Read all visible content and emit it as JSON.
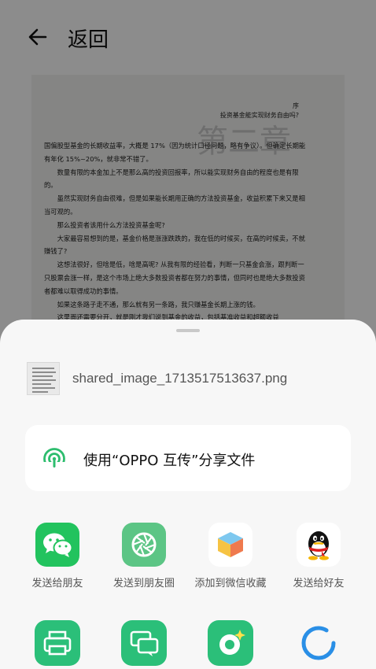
{
  "header": {
    "back_label": "返回"
  },
  "document": {
    "header_lines": [
      "序",
      "投资基金能实现财务自由吗?"
    ],
    "big_char": "第二章",
    "paragraphs": [
      {
        "indent": false,
        "text": "国偏股型基金的长期收益率，大概是 17%（因为统计口径问题，略有争议）。但确定长期能有年化 15%~20%，就非常不错了。"
      },
      {
        "indent": true,
        "text": "数量有限的本金加上不是那么高的投资回报率，所以能实现财务自由的程度也是有限的。"
      },
      {
        "indent": true,
        "text": "虽然实现财务自由很难，但是如果能长期用正确的方法投资基金，收益积累下来又是相当可观的。"
      },
      {
        "indent": true,
        "text": "那么投资者该用什么方法投资基金呢?"
      },
      {
        "indent": true,
        "text": "大家最容易想到的是，基金价格是涨涨跌跌的，我在低的时候买，在高的时候卖，不就赚钱了?"
      },
      {
        "indent": true,
        "text": "这想法很好，但啥是低，啥是高呢? 从我有限的经验看，判断一只基金会涨，跟判断一只股票会涨一样，是这个市场上绝大多数投资者都在努力的事情，但同时也是绝大多数投资者都难以取得成功的事情。"
      },
      {
        "indent": true,
        "text": "如果这条路子走不通，那么就有另一条路，我只赚基金长期上涨的钱。"
      },
      {
        "indent": true,
        "text": "这里面还需要分开，就是刚才我们说到基金的收益，包括基准收益和超额收益"
      }
    ]
  },
  "share_sheet": {
    "file_name": "shared_image_1713517513637.png",
    "oppo_share_label": "使用“OPPO 互传”分享文件",
    "apps_row1": [
      {
        "label": "发送给朋友",
        "icon": "wechat-icon",
        "color": "#2dc100"
      },
      {
        "label": "发送到朋友圈",
        "icon": "moments-icon",
        "color": "#5bc480"
      },
      {
        "label": "添加到微信收藏",
        "icon": "favorites-icon",
        "color": "#ffffff"
      },
      {
        "label": "发送给好友",
        "icon": "qq-icon",
        "color": "#ffffff"
      }
    ],
    "apps_row2": [
      {
        "icon": "print-icon",
        "color": "#2cc07a"
      },
      {
        "icon": "chat-bubbles-icon",
        "color": "#2cc07a"
      },
      {
        "icon": "camera-lens-icon",
        "color": "#2cc07a"
      },
      {
        "icon": "loading-ring-icon",
        "color": "#2a8fe6"
      }
    ]
  }
}
